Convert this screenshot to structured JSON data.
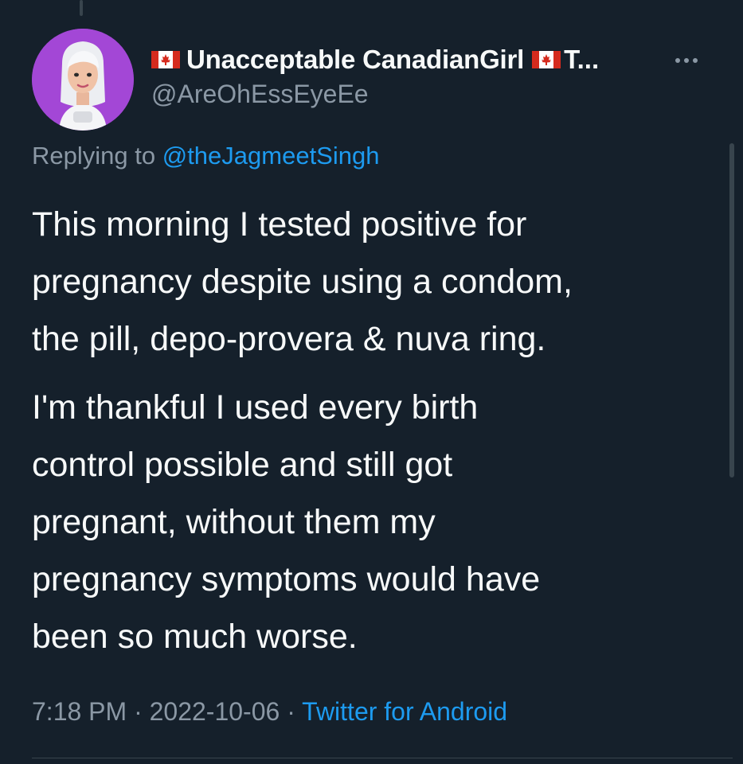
{
  "tweet": {
    "author": {
      "display_name": "Unacceptable CanadianGirl",
      "display_name_truncated": "T...",
      "handle": "@AreOhEssEyeEe"
    },
    "reply_prefix": "Replying to",
    "reply_to": "@theJagmeetSingh",
    "paragraphs": [
      "This morning I tested positive for\npregnancy despite using a condom,\nthe pill, depo-provera & nuva ring.",
      "I'm thankful I used every birth\ncontrol possible and still got\npregnant, without them my\npregnancy symptoms would have\nbeen so much worse."
    ],
    "time": "7:18 PM",
    "date": "2022-10-06",
    "source": "Twitter for Android",
    "separator": "·"
  },
  "icons": {
    "flag": "canada-flag-icon",
    "more": "more-options-icon",
    "avatar": "bitmoji-avatar"
  },
  "colors": {
    "background": "#15202b",
    "text_primary": "#f7f9f9",
    "text_secondary": "#8b98a5",
    "link": "#1d9bf0",
    "avatar_bg": "#a347d6",
    "flag_red": "#d52b1e"
  }
}
